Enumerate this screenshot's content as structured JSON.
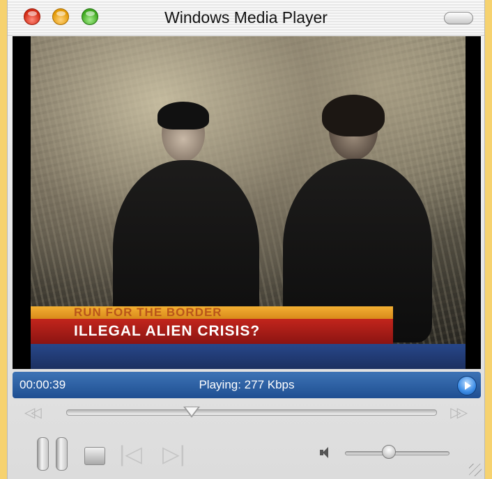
{
  "window": {
    "title": "Windows Media Player"
  },
  "video": {
    "lower_third": {
      "top_line": "RUN FOR THE BORDER",
      "bottom_line": "ILLEGAL ALIEN CRISIS?"
    }
  },
  "status": {
    "time": "00:00:39",
    "playing": "Playing: 277 Kbps"
  },
  "seek": {
    "progress": 0.34
  },
  "volume": {
    "level": 0.42
  },
  "icons": {
    "close": "close-icon",
    "minimize": "minimize-icon",
    "zoom": "zoom-icon",
    "toolbar": "toolbar-toggle-icon",
    "skip_back": "skip-back-icon",
    "skip_forward": "skip-forward-icon",
    "pause": "pause-icon",
    "stop": "stop-icon",
    "previous": "previous-icon",
    "next": "next-icon",
    "speaker": "speaker-icon",
    "go": "status-go-icon",
    "resize": "resize-grip-icon"
  },
  "colors": {
    "status_bar": "#2b5fa3",
    "lower_third_orange": "#e89d24",
    "lower_third_red": "#a81c17",
    "background": "#f6d26f"
  }
}
